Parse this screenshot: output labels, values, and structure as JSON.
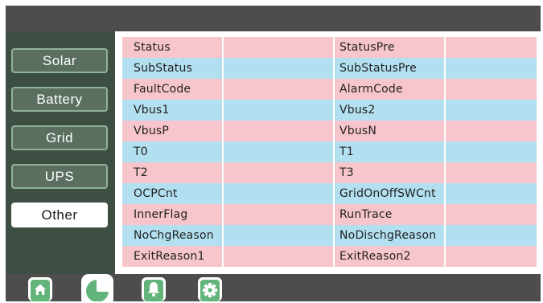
{
  "sidebar": {
    "items": [
      {
        "label": "Solar"
      },
      {
        "label": "Battery"
      },
      {
        "label": "Grid"
      },
      {
        "label": "UPS"
      },
      {
        "label": "Other"
      }
    ],
    "active": "Other"
  },
  "table": {
    "rows": [
      {
        "left": "Status",
        "right": "StatusPre"
      },
      {
        "left": "SubStatus",
        "right": "SubStatusPre"
      },
      {
        "left": "FaultCode",
        "right": "AlarmCode"
      },
      {
        "left": "Vbus1",
        "right": "Vbus2"
      },
      {
        "left": "VbusP",
        "right": "VbusN"
      },
      {
        "left": "T0",
        "right": "T1"
      },
      {
        "left": "T2",
        "right": "T3"
      },
      {
        "left": "OCPCnt",
        "right": "GridOnOffSWCnt"
      },
      {
        "left": "InnerFlag",
        "right": "RunTrace"
      },
      {
        "left": "NoChgReason",
        "right": "NoDischgReason"
      },
      {
        "left": "ExitReason1",
        "right": "ExitReason2"
      }
    ]
  },
  "bottom_tabs": [
    {
      "icon": "home-icon"
    },
    {
      "icon": "pie-chart-icon",
      "active": true
    },
    {
      "icon": "bell-icon"
    },
    {
      "icon": "gear-icon"
    }
  ],
  "colors": {
    "titlebar": "#4d4d4d",
    "sidebar": "#3c4f42",
    "row_pink": "#f7c6cc",
    "row_blue": "#b3e0f0",
    "icon_green": "#62b47a"
  }
}
